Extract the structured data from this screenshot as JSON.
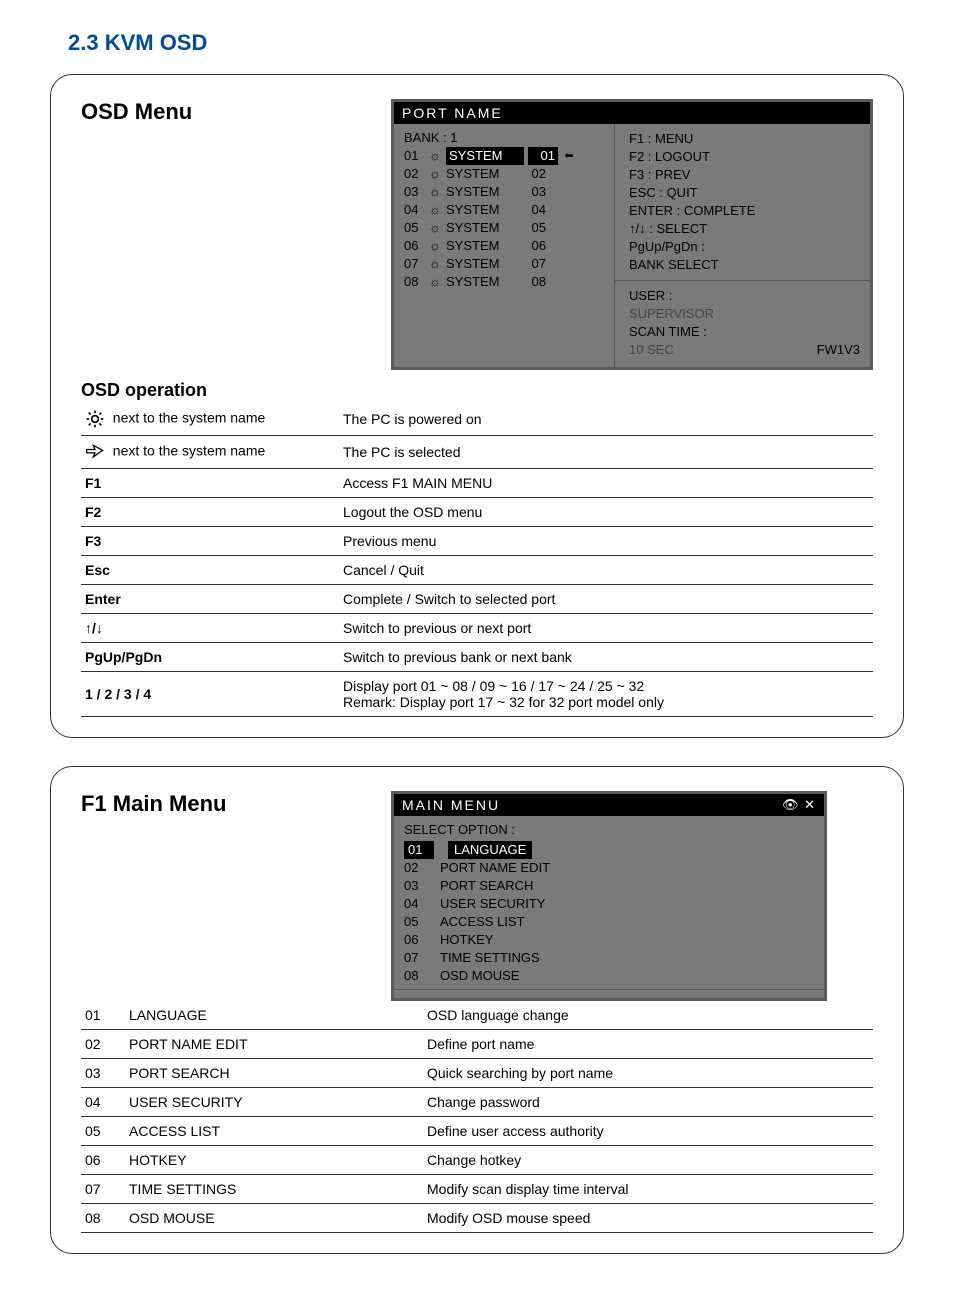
{
  "section_title": "2.3  KVM OSD",
  "osd_menu": {
    "title": "OSD Menu",
    "screen_title": "PORT  NAME",
    "bank_label": "BANK : 1",
    "ports": [
      {
        "num": "01",
        "name": "SYSTEM",
        "rn": "01",
        "sel": true,
        "hl": true
      },
      {
        "num": "02",
        "name": "SYSTEM",
        "rn": "02",
        "sel": false,
        "hl": false
      },
      {
        "num": "03",
        "name": "SYSTEM",
        "rn": "03",
        "sel": false,
        "hl": false
      },
      {
        "num": "04",
        "name": "SYSTEM",
        "rn": "04",
        "sel": false,
        "hl": false
      },
      {
        "num": "05",
        "name": "SYSTEM",
        "rn": "05",
        "sel": false,
        "hl": false
      },
      {
        "num": "06",
        "name": "SYSTEM",
        "rn": "06",
        "sel": false,
        "hl": false
      },
      {
        "num": "07",
        "name": "SYSTEM",
        "rn": "07",
        "sel": false,
        "hl": false
      },
      {
        "num": "08",
        "name": "SYSTEM",
        "rn": "08",
        "sel": false,
        "hl": false
      }
    ],
    "hints_top": [
      "F1 : MENU",
      "F2 : LOGOUT",
      "F3 : PREV",
      "ESC : QUIT",
      "ENTER : COMPLETE",
      "✦/✦ : SELECT",
      "PgUp/PgDn :",
      "BANK SELECT"
    ],
    "hints_bot": {
      "user_lbl": "USER :",
      "user_val": "SUPERVISOR",
      "scan_lbl": "SCAN TIME :",
      "scan_val": "10 SEC",
      "fw": "FW1V3"
    }
  },
  "osd_operation": {
    "title": "OSD operation",
    "rows": [
      {
        "key_icon": "sun",
        "key_text": "next to the system name",
        "desc": "The PC is powered on"
      },
      {
        "key_icon": "mouse",
        "key_text": "next to the system name",
        "desc": "The PC is selected"
      },
      {
        "key": "F1",
        "desc": "Access F1 MAIN MENU"
      },
      {
        "key": "F2",
        "desc": "Logout the OSD menu"
      },
      {
        "key": "F3",
        "desc": "Previous menu"
      },
      {
        "key": "Esc",
        "desc": "Cancel / Quit"
      },
      {
        "key": "Enter",
        "desc": "Complete / Switch to selected port"
      },
      {
        "key_icon": "arrows",
        "desc": "Switch to previous or next port"
      },
      {
        "key": "PgUp/PgDn",
        "desc": "Switch to previous bank or next bank"
      },
      {
        "key": "1 / 2 / 3 / 4",
        "desc": "Display port  01 ~ 08 / 09 ~ 16 / 17 ~ 24 / 25 ~ 32\nRemark:  Display port 17 ~ 32 for 32 port model only"
      }
    ]
  },
  "f1_menu": {
    "title": "F1 Main Menu",
    "screen_title": "MAIN  MENU",
    "select_opt": "SELECT OPTION :",
    "options": [
      {
        "n": "01",
        "l": "LANGUAGE",
        "hl": true
      },
      {
        "n": "02",
        "l": "PORT NAME  EDIT"
      },
      {
        "n": "03",
        "l": "PORT SEARCH"
      },
      {
        "n": "04",
        "l": "USER SECURITY"
      },
      {
        "n": "05",
        "l": "ACCESS LIST"
      },
      {
        "n": "06",
        "l": "HOTKEY"
      },
      {
        "n": "07",
        "l": "TIME SETTINGS"
      },
      {
        "n": "08",
        "l": "OSD MOUSE"
      }
    ],
    "table": [
      {
        "n": "01",
        "l": "LANGUAGE",
        "d": "OSD language change"
      },
      {
        "n": "02",
        "l": "PORT NAME EDIT",
        "d": "Define port name"
      },
      {
        "n": "03",
        "l": "PORT SEARCH",
        "d": "Quick searching by port name"
      },
      {
        "n": "04",
        "l": "USER SECURITY",
        "d": "Change password"
      },
      {
        "n": "05",
        "l": "ACCESS LIST",
        "d": "Define user access authority"
      },
      {
        "n": "06",
        "l": "HOTKEY",
        "d": "Change hotkey"
      },
      {
        "n": "07",
        "l": "TIME SETTINGS",
        "d": "Modify scan display time interval"
      },
      {
        "n": "08",
        "l": "OSD MOUSE",
        "d": "Modify OSD mouse speed"
      }
    ]
  }
}
